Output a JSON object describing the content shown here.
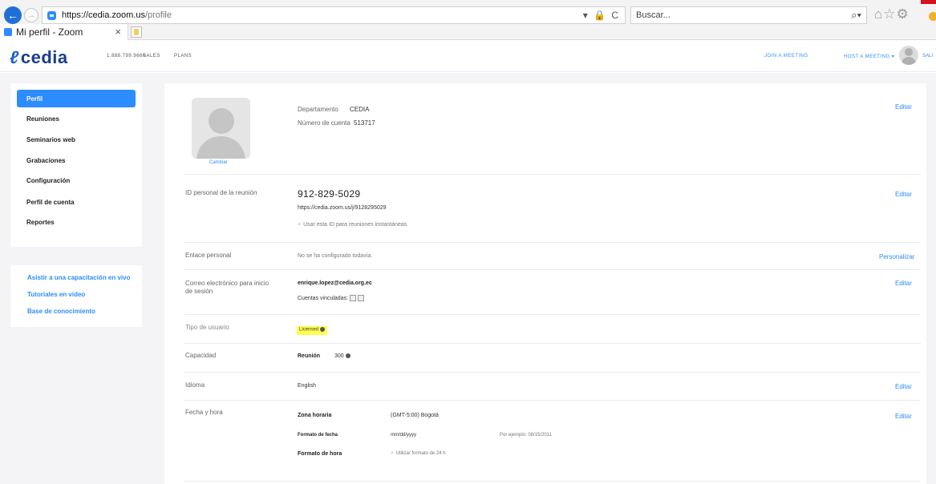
{
  "browser": {
    "url_host": "https://cedia.zoom.us",
    "url_path": "/profile",
    "search_placeholder": "Buscar...",
    "tab_title": "Mi perfil - Zoom",
    "tab_close": "×",
    "addr_icons": "▾ 🔒 C"
  },
  "header": {
    "logo": "cedia",
    "phone": "1.888.799.9666",
    "sales": "SALES",
    "plans": "PLANS",
    "join": "JOIN A MEETING",
    "host": "HOST A MEETING ▾",
    "user": "SALI"
  },
  "sidebar": {
    "items": [
      {
        "label": "Perfil"
      },
      {
        "label": "Reuniones"
      },
      {
        "label": "Seminarios web"
      },
      {
        "label": "Grabaciones"
      },
      {
        "label": "Configuración"
      },
      {
        "label": "Perfil de cuenta"
      },
      {
        "label": "Reportes"
      }
    ],
    "help": [
      {
        "label": "Asistir a una capacitación en vivo"
      },
      {
        "label": "Tutoriales en video"
      },
      {
        "label": "Base de conocimiento"
      }
    ]
  },
  "profile": {
    "change_photo": "Cambiar",
    "department_label": "Departamento",
    "department_value": "CEDIA",
    "account_label": "Número de cuenta",
    "account_value": "513717",
    "edit": "Editar",
    "pmi_label": "ID personal de la reunión",
    "pmi_number": "912-829-5029",
    "pmi_url": "https://cedia.zoom.us/j/9128295029",
    "pmi_instant": "Usar esta ID para reuniones instantáneas",
    "link_label": "Enlace personal",
    "link_value": "No se ha configurado todavía.",
    "link_action": "Personalizar",
    "email_label_1": "Correo electrónico para inicio",
    "email_label_2": "de sesión",
    "email_value": "enrique.lopez@cedia.org.ec",
    "linked_label": "Cuentas vinculadas:",
    "user_type_label": "Tipo de usuario",
    "user_type_value": "Licensed",
    "capacity_label": "Capacidad",
    "capacity_meeting": "Reunión",
    "capacity_value": "300",
    "language_label": "Idioma",
    "language_value": "English",
    "datetime_label": "Fecha y hora",
    "tz_label": "Zona horaria",
    "tz_value": "(GMT-5:00) Bogotá",
    "date_format_label": "Formato de fecha",
    "date_format_value": "mm/dd/yyyy",
    "date_example": "Por ejemplo: 08/15/2011",
    "time_format_label": "Formato de hora",
    "time_format_value": "Utilizar formato de 24 h"
  }
}
